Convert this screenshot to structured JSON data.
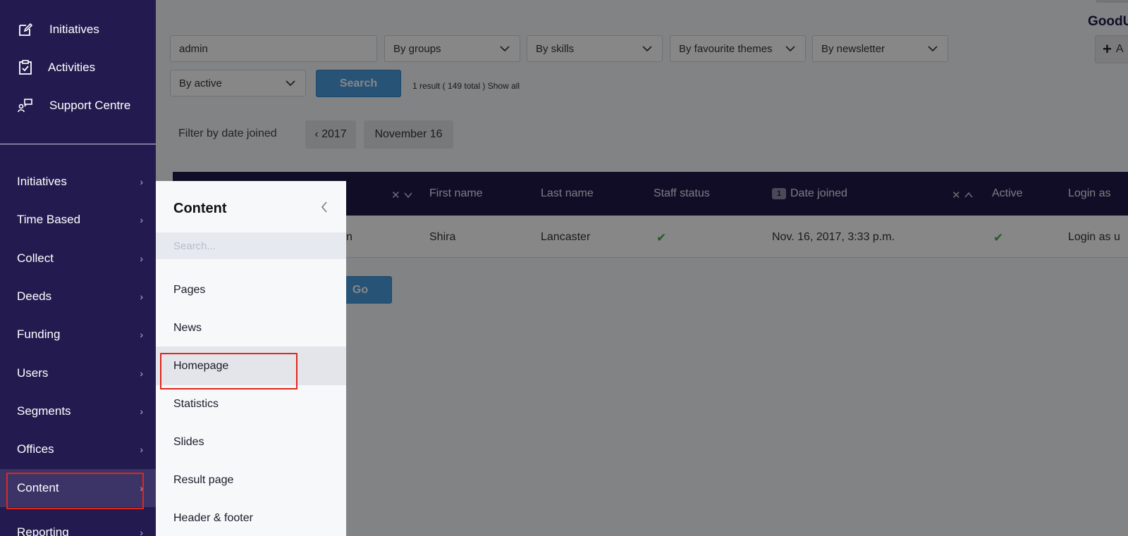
{
  "sidebar": {
    "top_items": [
      {
        "label": "Initiatives",
        "icon": "edit-icon"
      },
      {
        "label": "Activities",
        "icon": "clipboard-check-icon"
      },
      {
        "label": "Support Centre",
        "icon": "support-icon"
      }
    ],
    "nav_items": [
      {
        "label": "Initiatives",
        "arrow": "›"
      },
      {
        "label": "Time Based",
        "arrow": "›"
      },
      {
        "label": "Collect",
        "arrow": "›"
      },
      {
        "label": "Deeds",
        "arrow": "›"
      },
      {
        "label": "Funding",
        "arrow": "›"
      },
      {
        "label": "Users",
        "arrow": "›"
      },
      {
        "label": "Segments",
        "arrow": "›"
      },
      {
        "label": "Offices",
        "arrow": "›"
      },
      {
        "label": "Content",
        "arrow": "›"
      },
      {
        "label": "Reporting",
        "arrow": "›"
      }
    ],
    "active_item": "Content"
  },
  "flyout": {
    "title": "Content",
    "search_placeholder": "Search...",
    "items": [
      {
        "label": "Pages"
      },
      {
        "label": "News"
      },
      {
        "label": "Homepage"
      },
      {
        "label": "Statistics"
      },
      {
        "label": "Slides"
      },
      {
        "label": "Result page"
      },
      {
        "label": "Header & footer"
      }
    ],
    "active_item": "Homepage"
  },
  "header": {
    "org_title": "GoodU",
    "add_button": "A"
  },
  "filters": {
    "search_value": "admin",
    "groups": "By groups",
    "skills": "By skills",
    "themes": "By favourite themes",
    "newsletter": "By newsletter",
    "active": "By active",
    "search_button": "Search",
    "result_text": "1 result ( 149 total )",
    "show_all": "Show all",
    "date_filter_label": "Filter by date joined",
    "date_back": "‹ 2017",
    "date_current": "November 16"
  },
  "table": {
    "headers": {
      "first_name": "First name",
      "last_name": "Last name",
      "staff_status": "Staff status",
      "date_joined": "Date joined",
      "date_sort_badge": "1",
      "active": "Active",
      "login_as": "Login as"
    },
    "row": {
      "email_partial": "n",
      "first_name": "Shira",
      "last_name": "Lancaster",
      "staff_status": "✔",
      "date_joined": "Nov. 16, 2017, 3:33 p.m.",
      "active": "✔",
      "login_as": "Login as u"
    }
  },
  "actions": {
    "go_button": "Go"
  },
  "colors": {
    "sidebar_bg": "#231b50",
    "accent_blue": "#4a9de0",
    "highlight_red": "#e0271c",
    "table_header": "#201a4a",
    "check_green": "#4aa84e"
  }
}
